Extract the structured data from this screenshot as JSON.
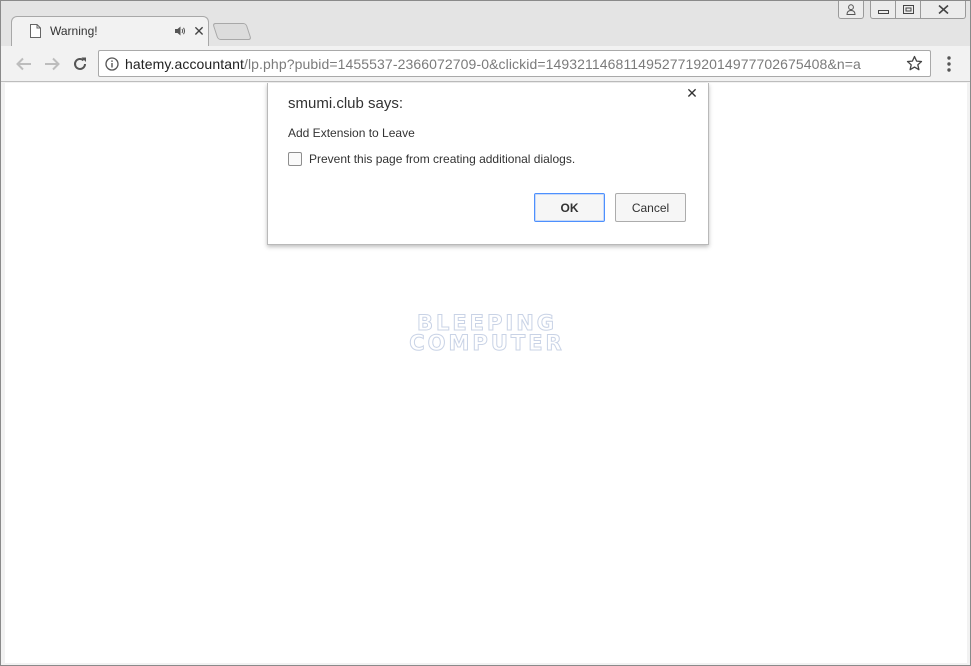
{
  "tab": {
    "title": "Warning!"
  },
  "address_bar": {
    "host": "hatemy.accountant",
    "path": "/lp.php?pubid=1455537-2366072709-0&clickid=149321146811495277192014977702675408&n=a"
  },
  "watermark": {
    "line1": "BLEEPING",
    "line2": "COMPUTER"
  },
  "dialog": {
    "title": "smumi.club says:",
    "message": "Add Extension to Leave",
    "checkbox_label": "Prevent this page from creating additional dialogs.",
    "ok_label": "OK",
    "cancel_label": "Cancel"
  },
  "colors": {
    "focus_ring": "#4d90fe",
    "watermark": "#c9d3e6"
  }
}
